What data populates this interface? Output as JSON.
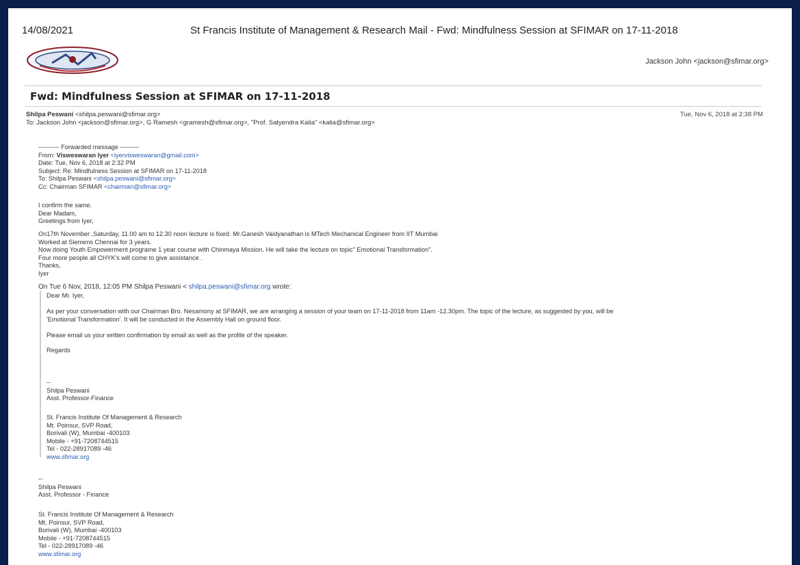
{
  "print_header": {
    "date": "14/08/2021",
    "title": "St Francis Institute of Management & Research Mail - Fwd: Mindfulness Session at SFIMAR on 17-11-2018"
  },
  "account": {
    "name": "Jackson John",
    "email": "<jackson@sfimar.org>"
  },
  "email": {
    "subject": "Fwd: Mindfulness Session at SFIMAR on 17-11-2018",
    "from_name": "Shilpa Peswani",
    "from_email": "<shilpa.peswani@sfimar.org>",
    "to_line": "To: Jackson John <jackson@sfimar.org>, G Ramesh <gramesh@sfimar.org>, \"Prof. Satyendra Kalia\" <kalia@sfimar.org>",
    "date": "Tue, Nov 6, 2018 at 2:38 PM"
  },
  "forwarded": {
    "marker": "---------- Forwarded message ---------",
    "from_label": "From:",
    "from_name": "Visweswaran Iyer",
    "from_email": "<iyervisweswaran@gmail.com>",
    "date_line": "Date: Tue, Nov 6, 2018 at 2:32 PM",
    "subject_line": "Subject: Re: Mindfulness Session at SFIMAR on 17-11-2018",
    "to_label": "To: Shilpa Peswani",
    "to_email": "<shilpa.peswani@sfimar.org>",
    "cc_label": "Cc: Chairman SFIMAR",
    "cc_email": "<chairman@sfimar.org>"
  },
  "reply": {
    "lines": [
      "I confirm the same.",
      "Dear Madam,",
      "Greetings from Iyer,"
    ],
    "details": [
      "On17th November ,Saturday, 11.00 am to 12.30 noon lecture is fixed. Mr.Ganesh Vaidyanathan is MTech Mechanical Engineer from IIT Mumbai",
      "Worked at Siemens Chennai for 3 years.",
      "Now doing Youth Empowerment programe 1 year course with Chinmaya Mission. He will take the lecture on topic\" Emotional Transformation\".",
      "Four more people all CHYK's will come to give assistance .",
      "Thanks,",
      "Iyer"
    ]
  },
  "quoted": {
    "intro": "On Tue 6 Nov, 2018, 12:05 PM Shilpa Peswani <",
    "email": "shilpa.peswani@sfimar.org",
    "wrote": " wrote:",
    "greeting": "Dear Mr. Iyer,",
    "para": [
      "As per your conversation with our Chairman Bro. Nesamony at SFIMAR, we are arranging a session of your team on 17-11-2018 from 11am -12.30pm. The topic of the lecture, as suggested by you, will be",
      "'Emotional Transformation'. It will be conducted in the Assembly Hall on ground floor."
    ],
    "request": "Please email us your written confirmation by email as well as the profile of the speaker.",
    "regards": "Regards",
    "signature": {
      "dashes": "--",
      "name": "Shilpa Peswani",
      "role": "Asst. Professor-Finance"
    },
    "address": [
      "St. Francis Institute Of Management & Research",
      "Mt. Poinsur, SVP Road,",
      "Borivali (W), Mumbai -400103",
      "Mobile - +91-7208744515",
      "Tel - 022-28917089 -46",
      "www.sfimar.org"
    ]
  },
  "signature": {
    "dashes": "--",
    "name": "Shilpa Peswani",
    "role": "Asst. Professor - Finance",
    "address": [
      "St. Francis Institute Of Management & Research",
      "Mt. Poinsur, SVP Road,",
      "Borivali (W), Mumbai -400103",
      "Mobile - +91-7208744515",
      "Tel - 022-28917089 -46",
      "www.sfimar.org"
    ]
  },
  "colors": {
    "frame": "#0a1f4a",
    "link": "#2a5db0",
    "logo_red": "#8a1f2a",
    "logo_blue": "#2f4a86"
  }
}
